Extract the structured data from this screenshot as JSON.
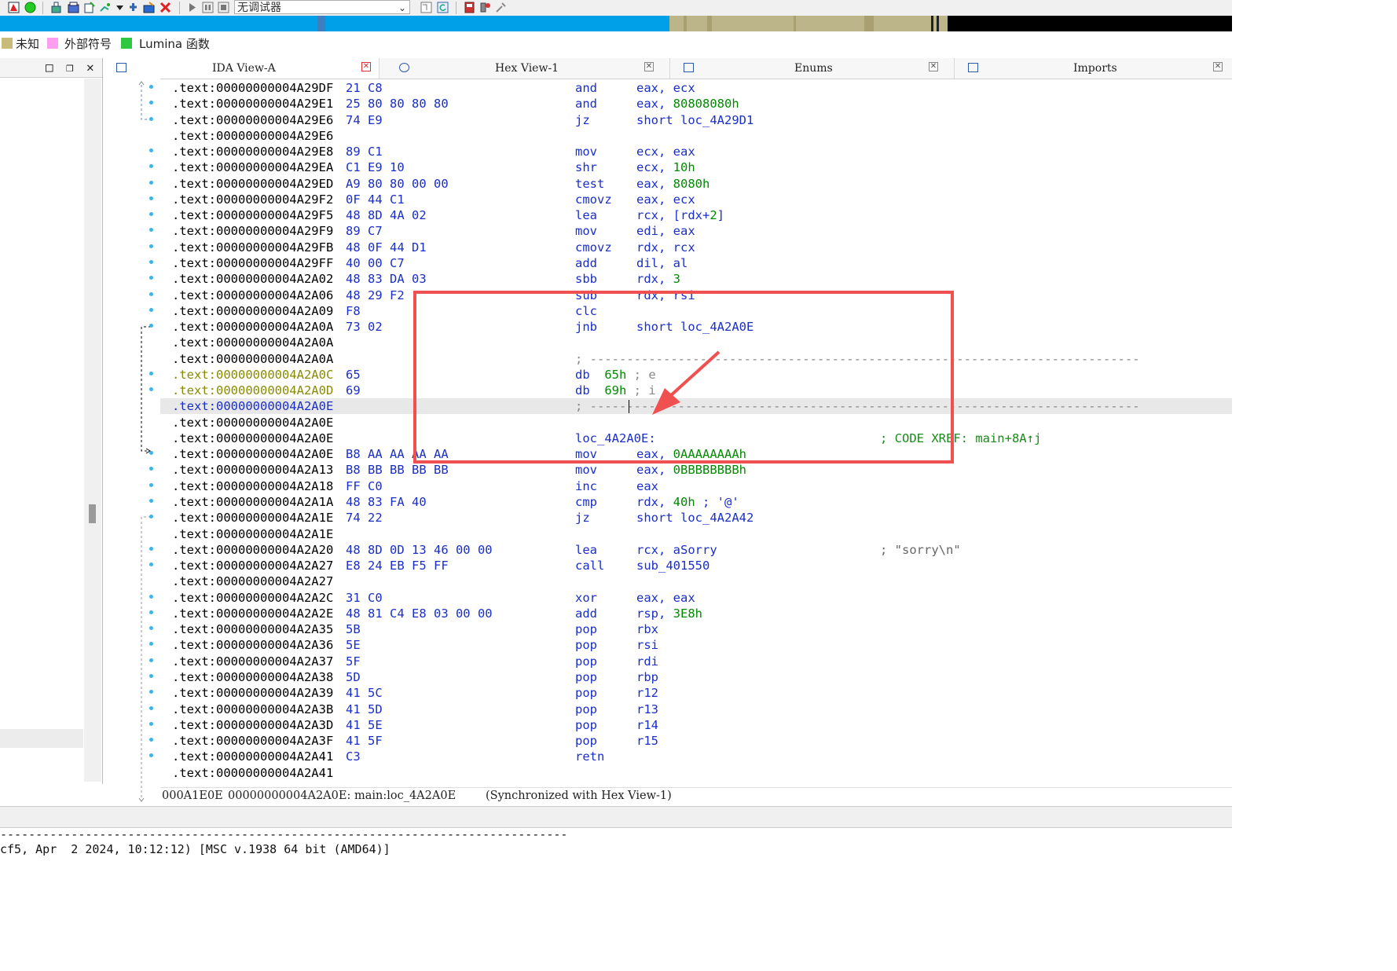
{
  "toolbar": {
    "debugger_select": "无调试器",
    "icons": [
      "map-icon",
      "run-icon",
      "stack-icon",
      "hex-icon",
      "func-icon",
      "down-icon",
      "struct-icon",
      "graph-icon",
      "close-red-icon",
      "play-icon",
      "pause-icon",
      "stop-icon",
      "step-icon",
      "refresh-icon",
      "book-icon",
      "net-icon",
      "plugin-icon"
    ]
  },
  "legend": [
    {
      "label": "未知",
      "color": "#c9bb7a"
    },
    {
      "label": "外部符号",
      "color": "#ff9ef0"
    },
    {
      "label": "Lumina 函数",
      "color": "#30c840"
    }
  ],
  "tabs": [
    {
      "label": "IDA View-A",
      "active": true
    },
    {
      "label": "Hex View-1",
      "active": false
    },
    {
      "label": "Enums",
      "active": false
    },
    {
      "label": "Imports",
      "active": false
    }
  ],
  "listing": [
    {
      "addr": ".text:00000000004A29DF",
      "bytes": "21 C8",
      "mnem": "and",
      "ops": "eax, ecx"
    },
    {
      "addr": ".text:00000000004A29E1",
      "bytes": "25 80 80 80 80",
      "mnem": "and",
      "ops": "eax, ",
      "num": "80808080h"
    },
    {
      "addr": ".text:00000000004A29E6",
      "bytes": "74 E9",
      "mnem": "jz",
      "ops": "short loc_4A29D1"
    },
    {
      "addr": ".text:00000000004A29E6",
      "bytes": "",
      "mnem": "",
      "ops": ""
    },
    {
      "addr": ".text:00000000004A29E8",
      "bytes": "89 C1",
      "mnem": "mov",
      "ops": "ecx, eax"
    },
    {
      "addr": ".text:00000000004A29EA",
      "bytes": "C1 E9 10",
      "mnem": "shr",
      "ops": "ecx, ",
      "num": "10h"
    },
    {
      "addr": ".text:00000000004A29ED",
      "bytes": "A9 80 80 00 00",
      "mnem": "test",
      "ops": "eax, ",
      "num": "8080h"
    },
    {
      "addr": ".text:00000000004A29F2",
      "bytes": "0F 44 C1",
      "mnem": "cmovz",
      "ops": "eax, ecx"
    },
    {
      "addr": ".text:00000000004A29F5",
      "bytes": "48 8D 4A 02",
      "mnem": "lea",
      "ops": "rcx, [rdx+",
      "num": "2",
      "ops2": "]"
    },
    {
      "addr": ".text:00000000004A29F9",
      "bytes": "89 C7",
      "mnem": "mov",
      "ops": "edi, eax"
    },
    {
      "addr": ".text:00000000004A29FB",
      "bytes": "48 0F 44 D1",
      "mnem": "cmovz",
      "ops": "rdx, rcx"
    },
    {
      "addr": ".text:00000000004A29FF",
      "bytes": "40 00 C7",
      "mnem": "add",
      "ops": "dil, al"
    },
    {
      "addr": ".text:00000000004A2A02",
      "bytes": "48 83 DA 03",
      "mnem": "sbb",
      "ops": "rdx, ",
      "num": "3"
    },
    {
      "addr": ".text:00000000004A2A06",
      "bytes": "48 29 F2",
      "mnem": "sub",
      "ops": "rdx, rsi"
    },
    {
      "addr": ".text:00000000004A2A09",
      "bytes": "F8",
      "mnem": "clc",
      "ops": ""
    },
    {
      "addr": ".text:00000000004A2A0A",
      "bytes": "73 02",
      "mnem": "jnb",
      "ops": "short loc_4A2A0E"
    },
    {
      "addr": ".text:00000000004A2A0A",
      "bytes": "",
      "mnem": "",
      "ops": ""
    },
    {
      "addr": ".text:00000000004A2A0A",
      "bytes": "",
      "dash": "; ---------------------------------------------------------------------------"
    },
    {
      "addr": ".text:00000000004A2A0C",
      "bytes": "65",
      "db": "db",
      "num": "65h",
      "rc": " ; e",
      "yellow": true
    },
    {
      "addr": ".text:00000000004A2A0D",
      "bytes": "69",
      "db": "db",
      "num": "69h",
      "rc": " ; i",
      "yellow": true
    },
    {
      "addr": ".text:00000000004A2A0E",
      "bytes": "",
      "dash": "; ---------------------------------------------------------------------------",
      "highlight": true
    },
    {
      "addr": ".text:00000000004A2A0E",
      "bytes": "",
      "mnem": "",
      "ops": ""
    },
    {
      "addr": ".text:00000000004A2A0E",
      "bytes": "",
      "mnem": "loc_4A2A0E:",
      "ops": "",
      "cmt": "; CODE XREF: main+8A↑j"
    },
    {
      "addr": ".text:00000000004A2A0E",
      "bytes": "B8 AA AA AA AA",
      "mnem": "mov",
      "ops": "eax, ",
      "num": "0AAAAAAAAh"
    },
    {
      "addr": ".text:00000000004A2A13",
      "bytes": "B8 BB BB BB BB",
      "mnem": "mov",
      "ops": "eax, ",
      "num": "0BBBBBBBBh"
    },
    {
      "addr": ".text:00000000004A2A18",
      "bytes": "FF C0",
      "mnem": "inc",
      "ops": "eax"
    },
    {
      "addr": ".text:00000000004A2A1A",
      "bytes": "48 83 FA 40",
      "mnem": "cmp",
      "ops": "rdx, ",
      "num": "40h",
      "ops2": " ; '@'"
    },
    {
      "addr": ".text:00000000004A2A1E",
      "bytes": "74 22",
      "mnem": "jz",
      "ops": "short loc_4A2A42"
    },
    {
      "addr": ".text:00000000004A2A1E",
      "bytes": "",
      "mnem": "",
      "ops": ""
    },
    {
      "addr": ".text:00000000004A2A20",
      "bytes": "48 8D 0D 13 46 00 00",
      "mnem": "lea",
      "ops": "rcx, aSorry",
      "cmt": "; \"sorry\\n\"",
      "cmtgray": true
    },
    {
      "addr": ".text:00000000004A2A27",
      "bytes": "E8 24 EB F5 FF",
      "mnem": "call",
      "ops": "sub_401550"
    },
    {
      "addr": ".text:00000000004A2A27",
      "bytes": "",
      "mnem": "",
      "ops": ""
    },
    {
      "addr": ".text:00000000004A2A2C",
      "bytes": "31 C0",
      "mnem": "xor",
      "ops": "eax, eax"
    },
    {
      "addr": ".text:00000000004A2A2E",
      "bytes": "48 81 C4 E8 03 00 00",
      "mnem": "add",
      "ops": "rsp, ",
      "num": "3E8h"
    },
    {
      "addr": ".text:00000000004A2A35",
      "bytes": "5B",
      "mnem": "pop",
      "ops": "rbx"
    },
    {
      "addr": ".text:00000000004A2A36",
      "bytes": "5E",
      "mnem": "pop",
      "ops": "rsi"
    },
    {
      "addr": ".text:00000000004A2A37",
      "bytes": "5F",
      "mnem": "pop",
      "ops": "rdi"
    },
    {
      "addr": ".text:00000000004A2A38",
      "bytes": "5D",
      "mnem": "pop",
      "ops": "rbp"
    },
    {
      "addr": ".text:00000000004A2A39",
      "bytes": "41 5C",
      "mnem": "pop",
      "ops": "r12"
    },
    {
      "addr": ".text:00000000004A2A3B",
      "bytes": "41 5D",
      "mnem": "pop",
      "ops": "r13"
    },
    {
      "addr": ".text:00000000004A2A3D",
      "bytes": "41 5E",
      "mnem": "pop",
      "ops": "r14"
    },
    {
      "addr": ".text:00000000004A2A3F",
      "bytes": "41 5F",
      "mnem": "pop",
      "ops": "r15"
    },
    {
      "addr": ".text:00000000004A2A41",
      "bytes": "C3",
      "mnem": "retn",
      "ops": ""
    },
    {
      "addr": ".text:00000000004A2A41",
      "bytes": "",
      "mnem": "",
      "ops": ""
    }
  ],
  "status": {
    "offset": "000A1E0E",
    "address": "00000000004A2A0E: main:loc_4A2A0E",
    "sync": "(Synchronized with Hex View-1)"
  },
  "output": {
    "dash_line": "--------------------------------------------------------------------------------",
    "version_line": "cf5, Apr  2 2024, 10:12:12) [MSC v.1938 64 bit (AMD64)]"
  },
  "colors": {
    "nav_blue": "#00a0e8",
    "nav_olive": "#bdb58a",
    "highlight_box": "#f05050",
    "address_blue": "#1a2ec8",
    "number_green": "#008a00"
  }
}
